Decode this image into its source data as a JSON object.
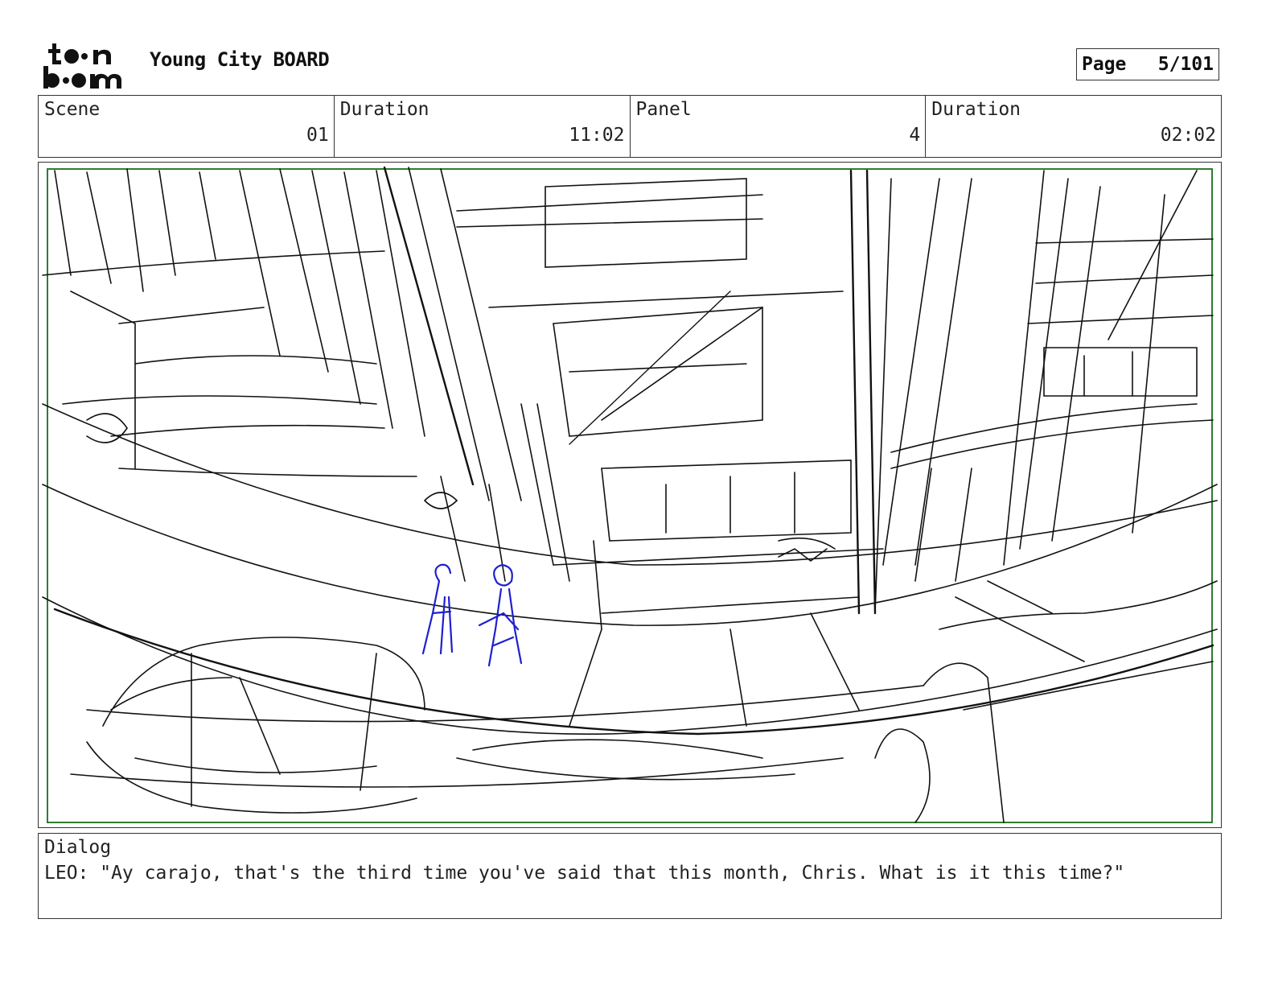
{
  "header": {
    "logo_text": "toon boom",
    "project_title": "Young City BOARD",
    "page_label": "Page",
    "page_value": "5/101"
  },
  "info": {
    "scene_label": "Scene",
    "scene_value": "01",
    "scene_duration_label": "Duration",
    "scene_duration_value": "11:02",
    "panel_label": "Panel",
    "panel_value": "4",
    "panel_duration_label": "Duration",
    "panel_duration_value": "02:02"
  },
  "panel": {
    "frame_color": "#2e7d32",
    "sketch_color": "#111111",
    "character_color": "#1f1fd0"
  },
  "dialog": {
    "label": "Dialog",
    "text": "LEO: \"Ay carajo, that's the third time you've said that this month, Chris. What is it this time?\""
  }
}
